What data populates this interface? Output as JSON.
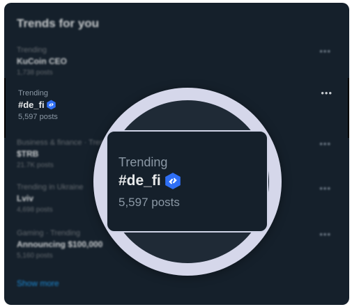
{
  "panel": {
    "title": "Trends for you",
    "show_more": "Show more",
    "more_icon": "more-dots-icon"
  },
  "trends": [
    {
      "meta": "Trending",
      "name": "KuCoin CEO",
      "count": "1,738 posts"
    },
    {
      "meta": "Trending",
      "name": "#de_fi",
      "count": "5,597 posts",
      "verified_badge": true
    },
    {
      "meta": "Business & finance · Trending",
      "name": "$TRB",
      "count": "21.7K posts"
    },
    {
      "meta": "Trending in Ukraine",
      "name": "Lviv",
      "count": "4,698 posts"
    },
    {
      "meta": "Gaming · Trending",
      "name": "Announcing $100,000",
      "count": "5,160 posts"
    }
  ],
  "magnified": {
    "meta": "Trending",
    "name": "#de_fi",
    "count": "5,597 posts"
  },
  "colors": {
    "background": "#15202b",
    "text_primary": "#e7e9ea",
    "text_secondary": "#71767b",
    "accent": "#1d9bf0",
    "badge": "#2f6ff5",
    "ring": "#d5d7ea"
  }
}
